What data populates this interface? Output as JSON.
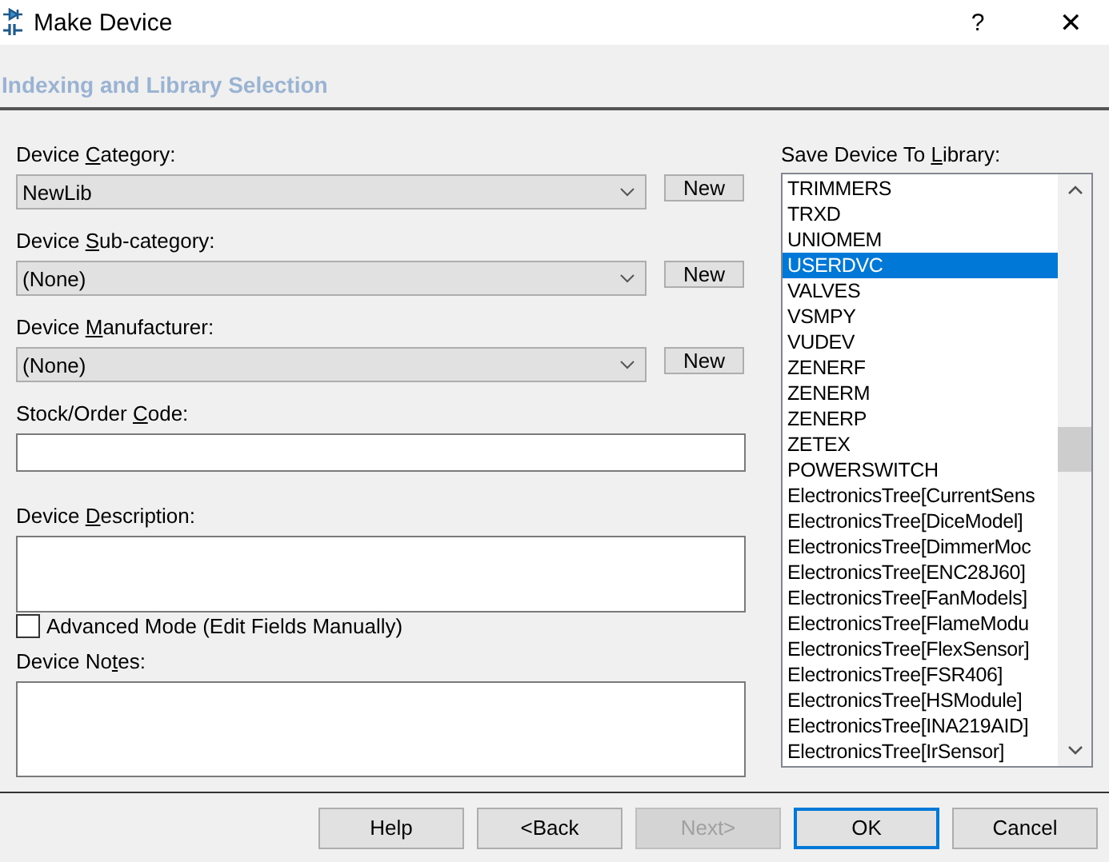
{
  "window": {
    "title": "Make Device",
    "help": "?",
    "close": "✕"
  },
  "header": "Indexing and Library Selection",
  "fields": [
    {
      "kind": "combo",
      "label": [
        {
          "t": "Device "
        },
        {
          "t": "C",
          "key": true
        },
        {
          "t": "ategory:"
        }
      ],
      "value": "NewLib",
      "button": "New"
    },
    {
      "kind": "combo",
      "label": [
        {
          "t": "Device "
        },
        {
          "t": "S",
          "key": true
        },
        {
          "t": "ub-category:"
        }
      ],
      "value": "(None)",
      "button": "New"
    },
    {
      "kind": "combo",
      "label": [
        {
          "t": "Device "
        },
        {
          "t": "M",
          "key": true
        },
        {
          "t": "anufacturer:"
        }
      ],
      "value": "(None)",
      "button": "New"
    },
    {
      "kind": "text",
      "label": [
        {
          "t": "Stock/Order "
        },
        {
          "t": "C",
          "key": true
        },
        {
          "t": "ode:"
        }
      ]
    },
    {
      "kind": "area",
      "label": [
        {
          "t": "Device "
        },
        {
          "t": "D",
          "key": true
        },
        {
          "t": "escription:"
        }
      ]
    },
    {
      "kind": "check",
      "label": [
        {
          "t": "Advanced Mode (Edit Fields Manually)"
        }
      ],
      "checked": false
    },
    {
      "kind": "area",
      "label": [
        {
          "t": "Device No"
        },
        {
          "t": "t",
          "key": true
        },
        {
          "t": "es:"
        }
      ]
    }
  ],
  "library": {
    "label": [
      {
        "t": "Save Device To "
      },
      {
        "t": "L",
        "key": true
      },
      {
        "t": "ibrary:"
      }
    ],
    "items": [
      {
        "text": "TRIMMERS",
        "selected": false
      },
      {
        "text": "TRXD",
        "selected": false
      },
      {
        "text": "UNIOMEM",
        "selected": false
      },
      {
        "text": "USERDVC",
        "selected": true
      },
      {
        "text": "VALVES",
        "selected": false
      },
      {
        "text": "VSMPY",
        "selected": false
      },
      {
        "text": "VUDEV",
        "selected": false
      },
      {
        "text": "ZENERF",
        "selected": false
      },
      {
        "text": "ZENERM",
        "selected": false
      },
      {
        "text": "ZENERP",
        "selected": false
      },
      {
        "text": "ZETEX",
        "selected": false
      },
      {
        "text": "POWERSWITCH",
        "selected": false
      },
      {
        "text": "ElectronicsTree[CurrentSens",
        "selected": false
      },
      {
        "text": "ElectronicsTree[DiceModel]",
        "selected": false
      },
      {
        "text": "ElectronicsTree[DimmerMoc",
        "selected": false
      },
      {
        "text": "ElectronicsTree[ENC28J60]",
        "selected": false
      },
      {
        "text": "ElectronicsTree[FanModels]",
        "selected": false
      },
      {
        "text": "ElectronicsTree[FlameModu",
        "selected": false
      },
      {
        "text": "ElectronicsTree[FlexSensor]",
        "selected": false
      },
      {
        "text": "ElectronicsTree[FSR406]",
        "selected": false
      },
      {
        "text": "ElectronicsTree[HSModule]",
        "selected": false
      },
      {
        "text": "ElectronicsTree[INA219AID]",
        "selected": false
      },
      {
        "text": "ElectronicsTree[IrSensor]",
        "selected": false
      }
    ]
  },
  "buttons": [
    {
      "label": "Help",
      "disabled": false,
      "default": false
    },
    {
      "label": "<Back",
      "disabled": false,
      "default": false
    },
    {
      "label": "Next>",
      "disabled": true,
      "default": false
    },
    {
      "label": "OK",
      "disabled": false,
      "default": true
    },
    {
      "label": "Cancel",
      "disabled": false,
      "default": false
    }
  ]
}
